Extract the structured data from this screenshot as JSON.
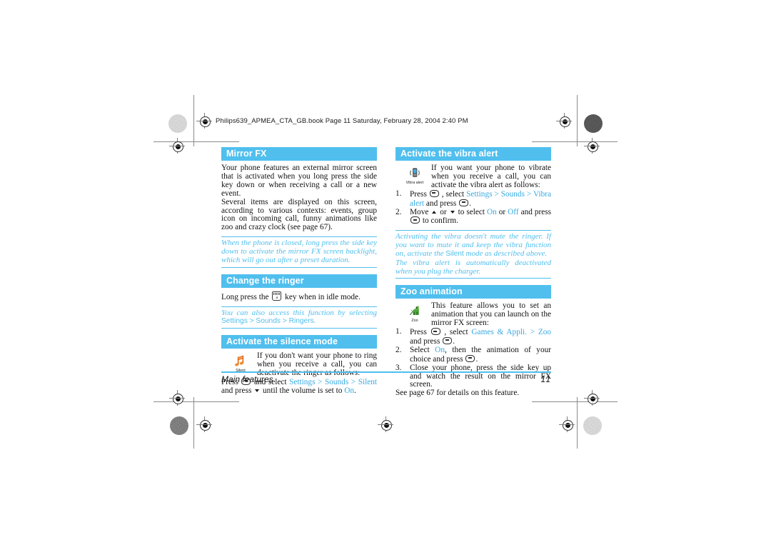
{
  "document": {
    "file_header": "Philips639_APMEA_CTA_GB.book  Page 11  Saturday, February 28, 2004  2:40 PM",
    "accent_color": "#50BFEE",
    "link_color": "#36A9E1",
    "footer": {
      "chapter": "Main features",
      "page_number": "11"
    }
  },
  "left_column": {
    "mirror_fx": {
      "heading": "Mirror FX",
      "paragraphs": [
        "Your phone features an external mirror screen that is activated when you long press the side key down or when receiving a call or a new event.",
        "Several items are displayed on this screen, according to various contexts: events, group icon on incoming call, funny animations like zoo and crazy clock (see page 67)."
      ],
      "note": "When the phone is closed, long press the side key down to activate the mirror FX screen backlight, which will go out after a preset duration."
    },
    "change_ringer": {
      "heading": "Change the ringer",
      "line_before_key": "Long press the",
      "key_icon": "hash-key-icon",
      "line_after_key": "key when in idle mode.",
      "note_italic": "You can also access this function by selecting",
      "note_path": "Settings > Sounds > Ringers."
    },
    "silence_mode": {
      "heading": "Activate the silence mode",
      "icon_name": "silent-musical-note-icon",
      "icon_caption": "Silent",
      "intro": "If you don't want your phone to ring when you receive a call, you can deactivate the ringer as follows:",
      "step_a": "Press",
      "step_b": "and select",
      "path_1": "Settings",
      "sep": ">",
      "path_2": "Sounds",
      "path_3": "Silent",
      "step_c": "and",
      "step_d": "press",
      "step_e": "until the volume is set to",
      "value_on": "On",
      "period": "."
    }
  },
  "right_column": {
    "vibra_alert": {
      "heading": "Activate the vibra alert",
      "icon_name": "vibra-alert-phone-icon",
      "icon_caption": "Vibra alert",
      "intro": "If you want your phone to vibrate when you receive a call, you can activate the vibra alert as follows:",
      "steps": [
        {
          "pre": "Press",
          "mid": ", select",
          "path": [
            "Settings",
            "Sounds",
            "Vibra alert"
          ],
          "post": "and press",
          "end": "."
        },
        {
          "pre": "Move",
          "mid": "or",
          "post": "to select",
          "on": "On",
          "orword": "or",
          "off": "Off",
          "tail": "and press",
          "end": "to confirm."
        }
      ],
      "note_1": "Activating the vibra doesn't mute the ringer. If you want to mute it and keep the vibra function on, activate the",
      "note_1_plain": "Silent",
      "note_1_tail": "mode as described above.",
      "note_2": "The vibra alert is automatically deactivated when you plug the charger."
    },
    "zoo_animation": {
      "heading": "Zoo animation",
      "icon_name": "zoo-animation-icon",
      "icon_caption": "Zoo",
      "intro": "This feature allows you to set an animation that you can launch on the mirror FX screen:",
      "steps": [
        {
          "pre": "Press",
          "mid": ", select",
          "path_1": "Games & Appli.",
          "sep": ">",
          "path_2": "Zoo",
          "post": "and press",
          "end": "."
        },
        {
          "pre": "Select",
          "value": "On",
          "post": ", then the animation of your choice and press",
          "end": "."
        },
        {
          "text": "Close your phone, press the side key up and watch the result on the mirror FX screen."
        }
      ],
      "see_also": "See page 67 for details on this feature."
    }
  }
}
